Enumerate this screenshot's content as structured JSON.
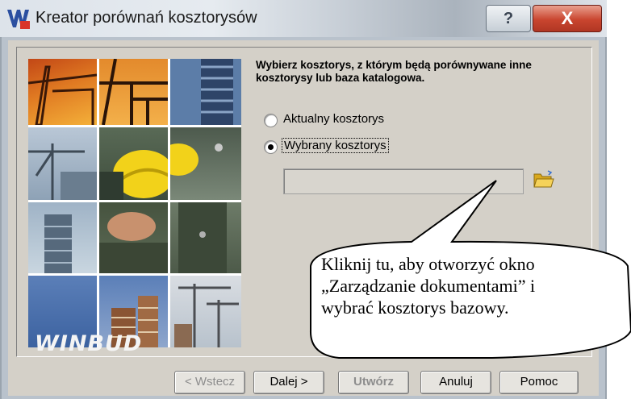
{
  "window": {
    "title": "Kreator porównań kosztorysów",
    "help_label": "?",
    "close_label": "X"
  },
  "picture": {
    "brand": "WINBUD"
  },
  "prompt": "Wybierz kosztorys, z którym będą porównywane inne kosztorysy lub baza katalogowa.",
  "options": [
    {
      "label": "Aktualny kosztorys",
      "selected": false
    },
    {
      "label": "Wybrany kosztorys",
      "selected": true
    }
  ],
  "path_input": {
    "value": ""
  },
  "icons": {
    "browse": "folder-open-icon",
    "app": "winbud-app-icon"
  },
  "buttons": {
    "back": "< Wstecz",
    "next": "Dalej >",
    "create": "Utwórz",
    "cancel": "Anuluj",
    "help": "Pomoc"
  },
  "callout": {
    "line1": "Kliknij tu, aby otworzyć okno",
    "line2": "„Zarządzanie dokumentami” i",
    "line3": "wybrać kosztorys bazowy."
  },
  "colors": {
    "dialog": "#d4d0c8",
    "close": "#c9452f",
    "helmet": "#f2d21a"
  }
}
